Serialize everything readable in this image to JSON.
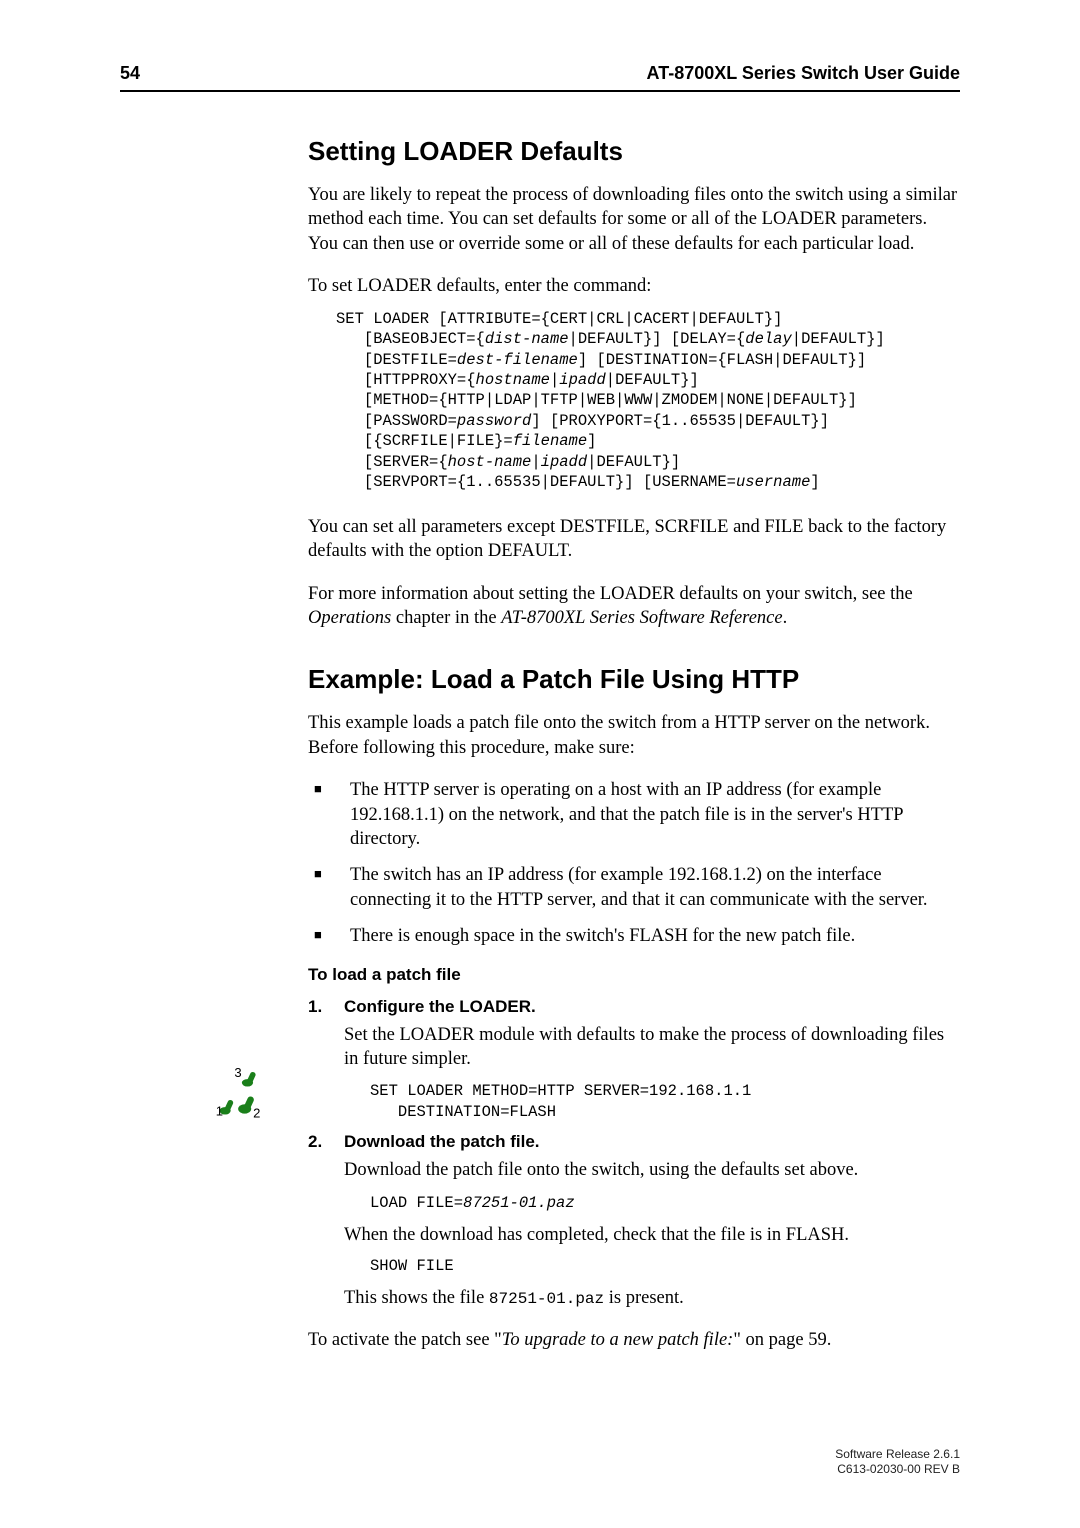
{
  "header": {
    "page_number": "54",
    "guide_title": "AT-8700XL Series Switch User Guide"
  },
  "section1": {
    "title": "Setting LOADER Defaults",
    "p1": "You are likely to repeat the process of downloading files onto the switch using a similar method each time. You can set defaults for some or all of the LOADER parameters. You can then use or override some or all of these defaults for each particular load.",
    "p2": "To set LOADER defaults, enter the command:",
    "code1_l1": "SET LOADER [ATTRIBUTE={CERT|CRL|CACERT|DEFAULT}]",
    "code1_l2a": "   [BASEOBJECT={",
    "code1_l2b": "dist-name",
    "code1_l2c": "|DEFAULT}] [DELAY={",
    "code1_l2d": "delay",
    "code1_l2e": "|DEFAULT}]",
    "code1_l3a": "   [DESTFILE=",
    "code1_l3b": "dest-filename",
    "code1_l3c": "] [DESTINATION={FLASH|DEFAULT}]",
    "code1_l4a": "   [HTTPPROXY={",
    "code1_l4b": "hostname",
    "code1_l4c": "|",
    "code1_l4d": "ipadd",
    "code1_l4e": "|DEFAULT}]",
    "code1_l5": "   [METHOD={HTTP|LDAP|TFTP|WEB|WWW|ZMODEM|NONE|DEFAULT}]",
    "code1_l6a": "   [PASSWORD=",
    "code1_l6b": "password",
    "code1_l6c": "] [PROXYPORT={1..65535|DEFAULT}]",
    "code1_l7a": "   [{SCRFILE|FILE}=",
    "code1_l7b": "filename",
    "code1_l7c": "]",
    "code1_l8a": "   [SERVER={",
    "code1_l8b": "host-name",
    "code1_l8c": "|",
    "code1_l8d": "ipadd",
    "code1_l8e": "|DEFAULT}]",
    "code1_l9a": "   [SERVPORT={1..65535|DEFAULT}] [USERNAME=",
    "code1_l9b": "username",
    "code1_l9c": "]",
    "p3": "You can set all parameters except DESTFILE, SCRFILE and FILE back to the factory defaults with the option DEFAULT.",
    "p4_a": "For more information about setting the LOADER defaults on your switch, see the ",
    "p4_b": "Operations",
    "p4_c": " chapter in the ",
    "p4_d": "AT-8700XL Series Software Reference",
    "p4_e": "."
  },
  "section2": {
    "title": "Example: Load a Patch File Using HTTP",
    "p1": "This example loads a patch file onto the switch from a HTTP server on the network. Before following this procedure, make sure:",
    "bullets": {
      "b1": "The HTTP server is operating on a host with an IP address (for example 192.168.1.1) on the network, and that the patch file is in the server's HTTP directory.",
      "b2": "The switch has an IP address (for example 192.168.1.2) on the interface connecting it to the HTTP server, and that it can communicate with the server.",
      "b3": "There is enough space in the switch's FLASH for the new patch file."
    },
    "proc_title": "To load a patch file",
    "step1_num": "1.",
    "step1_title": "Configure the LOADER.",
    "step1_body": "Set the LOADER module with defaults to make the process of downloading files in future simpler.",
    "step1_code_l1": "SET LOADER METHOD=HTTP SERVER=192.168.1.1",
    "step1_code_l2": "   DESTINATION=FLASH",
    "step2_num": "2.",
    "step2_title": "Download the patch file.",
    "step2_body1": "Download the patch file onto the switch, using the defaults set above.",
    "step2_code1a": "LOAD FILE=",
    "step2_code1b": "87251-01.paz",
    "step2_body2": "When the download has completed, check that the file is in FLASH.",
    "step2_code2": "SHOW FILE",
    "step2_body3a": "This shows the file ",
    "step2_body3b": "87251-01.paz",
    "step2_body3c": " is present.",
    "p_final_a": "To activate the patch see \"",
    "p_final_b": "To upgrade to a new patch file:",
    "p_final_c": "\" on page 59."
  },
  "footer": {
    "l1": "Software Release 2.6.1",
    "l2": "C613-02030-00 REV B"
  }
}
